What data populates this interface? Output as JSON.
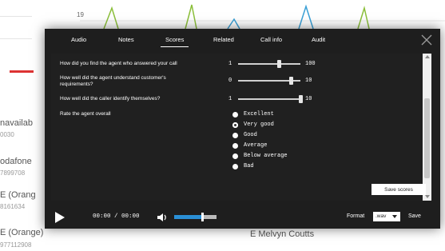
{
  "background": {
    "chart_tick": "19",
    "items": [
      {
        "name": "navailab",
        "number": "0030"
      },
      {
        "name": "odafone",
        "number": "7899708"
      },
      {
        "name": "E (Orang",
        "number": "8161634"
      }
    ],
    "bottom_item": {
      "name": "E (Orange)",
      "number": "977112908"
    },
    "person": "E Melvyn Coutts"
  },
  "modal": {
    "tabs": [
      {
        "label": "Audio"
      },
      {
        "label": "Notes"
      },
      {
        "label": "Scores",
        "active": true
      },
      {
        "label": "Related"
      },
      {
        "label": "Call info"
      },
      {
        "label": "Audit"
      }
    ],
    "close_icon": "close-icon",
    "questions": [
      {
        "text": "How did you find the agent who answered your call",
        "min": "1",
        "max": "100",
        "value": 0.65
      },
      {
        "text": "How well did the agent understand customer's requirements?",
        "min": "0",
        "max": "10",
        "value": 0.85
      },
      {
        "text": "How well did the caller identify themselves?",
        "min": "1",
        "max": "10",
        "value": 1.0
      },
      {
        "text": "Rate the agent overall"
      }
    ],
    "rating_options": [
      {
        "label": "Excellent",
        "selected": false
      },
      {
        "label": "Very good",
        "selected": true
      },
      {
        "label": "Good",
        "selected": false
      },
      {
        "label": "Average",
        "selected": false
      },
      {
        "label": "Below average",
        "selected": false
      },
      {
        "label": "Bad",
        "selected": false
      }
    ],
    "save_scores_label": "Save scores",
    "player": {
      "time": "00:00 / 00:00",
      "volume_level": 0.65,
      "format_label": "Format",
      "format_value": ".wav",
      "save_label": "Save"
    },
    "colors": {
      "volume_fill": "#2a8fd6",
      "background": "#1e1e1e"
    }
  }
}
